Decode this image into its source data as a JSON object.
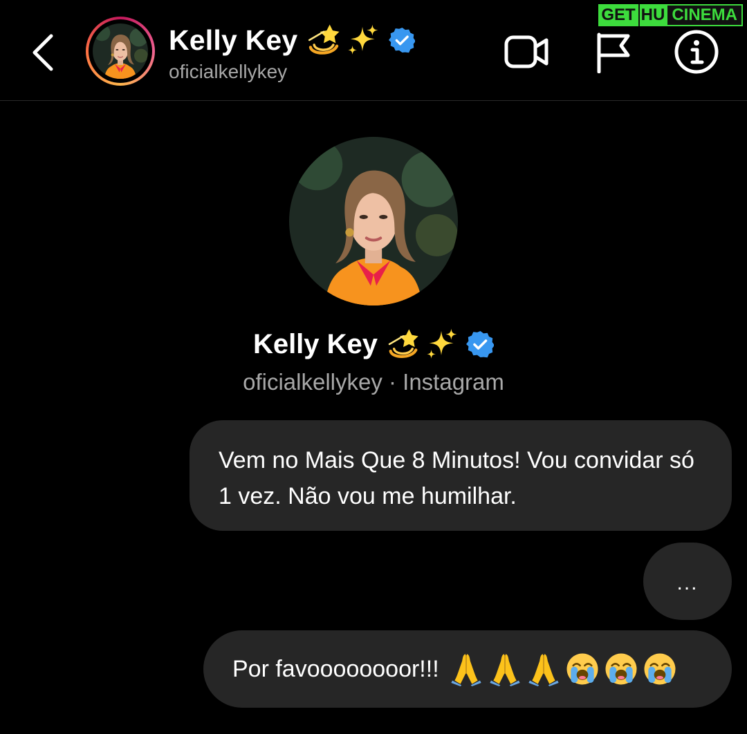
{
  "header": {
    "name": "Kelly Key",
    "username": "oficialkellykey",
    "back_icon": "chevron-left-icon",
    "actions": [
      {
        "name": "video-call",
        "icon": "video-camera-icon"
      },
      {
        "name": "report",
        "icon": "flag-icon"
      },
      {
        "name": "info",
        "icon": "info-icon"
      }
    ]
  },
  "profile": {
    "name": "Kelly Key",
    "subtitle": "oficialkellykey · Instagram",
    "name_emojis": [
      "dizzy-emoji",
      "sparkles-emoji",
      "verified-badge-icon"
    ]
  },
  "messages": [
    {
      "text": "Vem no Mais Que 8 Minutos! Vou convidar só 1 vez. Não vou me humilhar.",
      "sender": "me"
    },
    {
      "text": "...",
      "sender": "me"
    },
    {
      "text": "Por favoooooooor!!!",
      "sender": "me",
      "emojis": [
        "folded-hands",
        "folded-hands",
        "folded-hands",
        "crying-face",
        "crying-face",
        "crying-face"
      ]
    }
  ],
  "watermark": {
    "part1": "GET",
    "part2": "HU",
    "part3": "CINEMA"
  },
  "colors": {
    "background": "#000000",
    "bubble": "#262626",
    "secondary_text": "#a8a8a8",
    "verified_blue": "#3897f0"
  }
}
